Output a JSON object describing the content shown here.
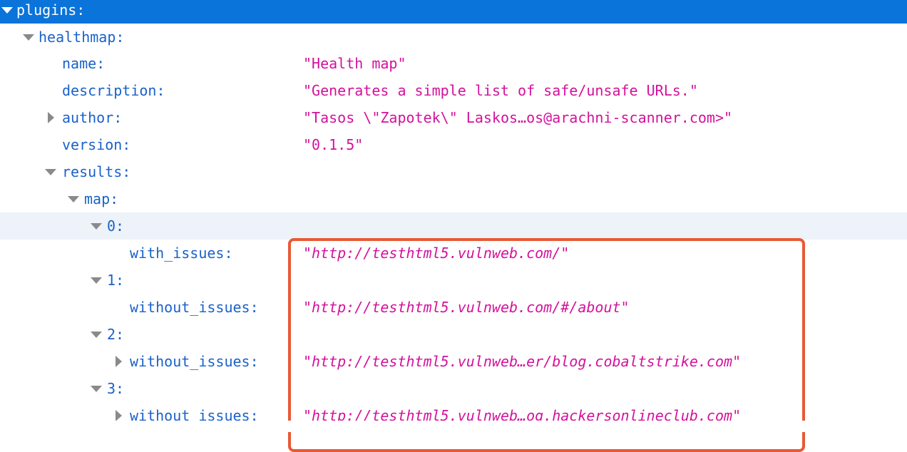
{
  "rows": {
    "plugins": {
      "key": "plugins:"
    },
    "healthmap": {
      "key": "healthmap:"
    },
    "name": {
      "key": "name:",
      "value": "\"Health map\""
    },
    "description": {
      "key": "description:",
      "value": "\"Generates a simple list of safe/unsafe URLs.\""
    },
    "author": {
      "key": "author:",
      "value": "\"Tasos \\\"Zapotek\\\" Laskos…os@arachni-scanner.com>\""
    },
    "version": {
      "key": "version:",
      "value": "\"0.1.5\""
    },
    "results": {
      "key": "results:"
    },
    "map": {
      "key": "map:"
    },
    "item0": {
      "key": "0:"
    },
    "item0_with_issues": {
      "key": "with_issues:",
      "url": "http://testhtml5.vulnweb.com/"
    },
    "item1": {
      "key": "1:"
    },
    "item1_without_issues": {
      "key": "without_issues:",
      "url": "http://testhtml5.vulnweb.com/#/about"
    },
    "item2": {
      "key": "2:"
    },
    "item2_without_issues": {
      "key": "without_issues:",
      "url": "http://testhtml5.vulnweb…er/blog.cobaltstrike.com"
    },
    "item3": {
      "key": "3:"
    },
    "item3_without_issues": {
      "key": "without_issues:",
      "url": "http://testhtml5.vulnweb…og.hackersonlineclub.com"
    }
  },
  "colors": {
    "selected_row": "#0a74da",
    "key": "#1a62c9",
    "string_value": "#d4119b",
    "highlight_box": "#e85a35"
  }
}
